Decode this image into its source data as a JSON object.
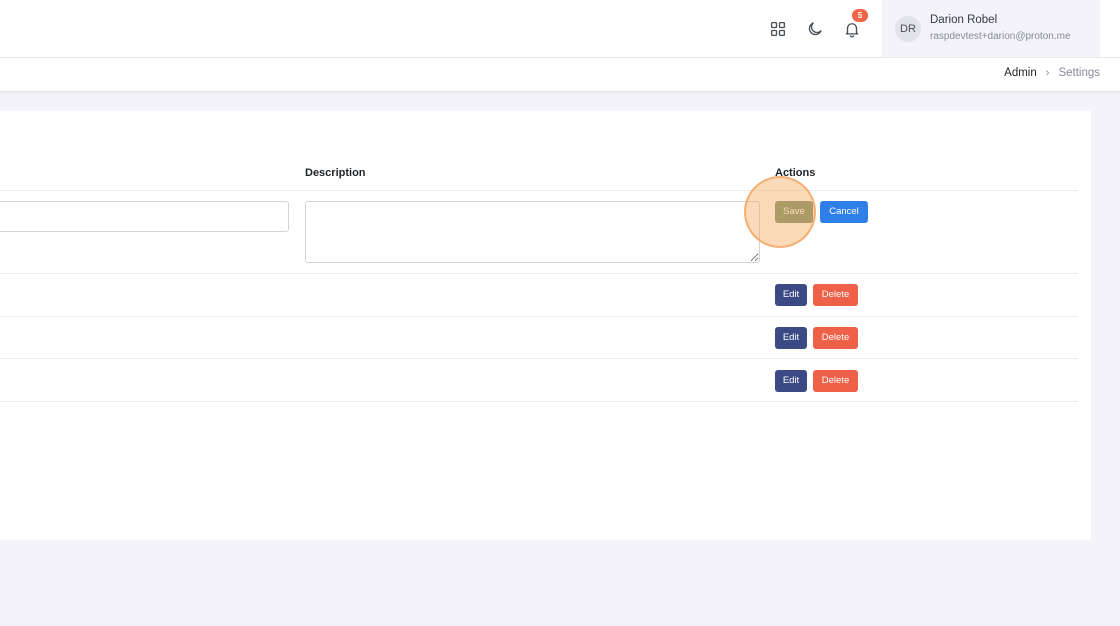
{
  "header": {
    "icons": [
      "apps-grid-icon",
      "moon-icon",
      "bell-icon"
    ],
    "notification_count": "5",
    "user": {
      "initials": "DR",
      "name": "Darion Robel",
      "email": "raspdevtest+darion@proton.me"
    }
  },
  "breadcrumb": {
    "items": [
      "Admin",
      "Settings"
    ]
  },
  "table": {
    "columns": {
      "description": "Description",
      "actions": "Actions"
    },
    "edit_row": {
      "name_value": "",
      "description_value": "",
      "save_label": "Save",
      "cancel_label": "Cancel"
    },
    "rows": [
      {
        "edit_label": "Edit",
        "delete_label": "Delete"
      },
      {
        "edit_label": "Edit",
        "delete_label": "Delete"
      },
      {
        "edit_label": "Edit",
        "delete_label": "Delete"
      }
    ]
  },
  "colors": {
    "save": "#6f8f6a",
    "cancel": "#2f7fe8",
    "edit": "#3b4a84",
    "delete": "#ef6048",
    "badge": "#f06548",
    "highlight": "#f7aa64"
  }
}
